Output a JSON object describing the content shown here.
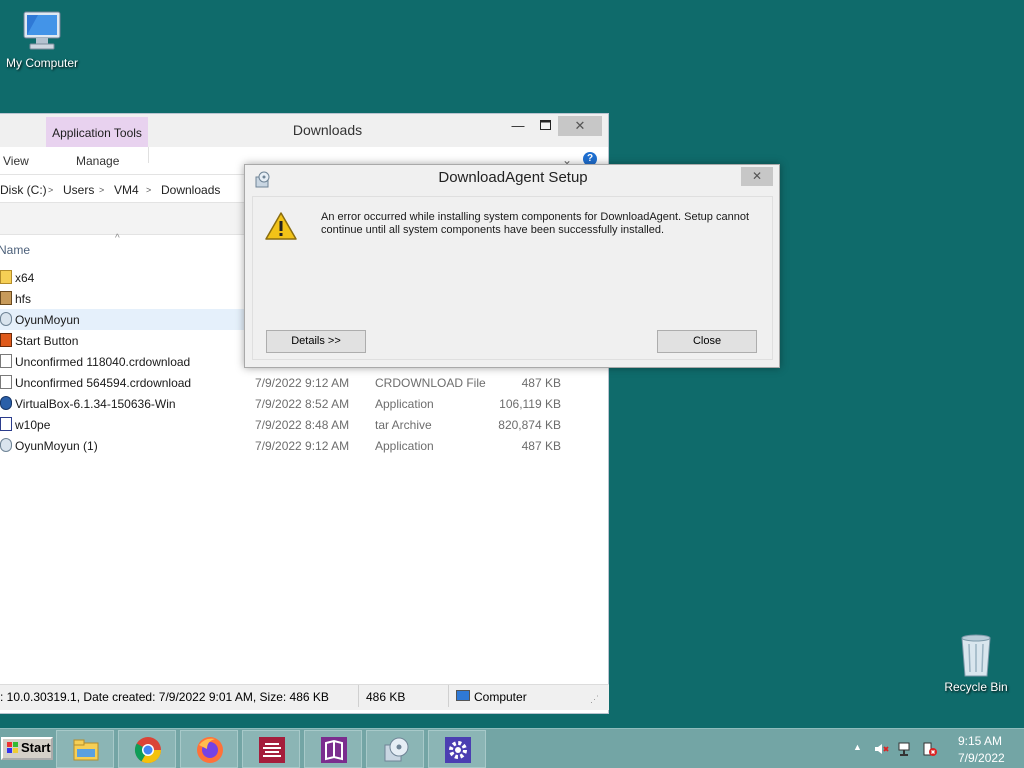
{
  "desktop": {
    "icons": [
      {
        "label": "My Computer"
      },
      {
        "label": "Recycle Bin"
      }
    ]
  },
  "explorer": {
    "title": "Downloads",
    "app_tools_tab": "Application Tools",
    "ribbon": {
      "view": "View",
      "manage": "Manage"
    },
    "breadcrumb": [
      "Disk (C:)",
      "Users",
      "VM4",
      "Downloads"
    ],
    "column_name": "Name",
    "files": [
      {
        "name": "x64",
        "date": "",
        "type": "",
        "size": "",
        "icon": "folder-icon"
      },
      {
        "name": "hfs",
        "date": "",
        "type": "",
        "size": "",
        "icon": "archive-icon"
      },
      {
        "name": "OyunMoyun",
        "date": "",
        "type": "",
        "size": "",
        "icon": "installer-icon"
      },
      {
        "name": "Start Button",
        "date": "",
        "type": "",
        "size": "",
        "icon": "image-icon"
      },
      {
        "name": "Unconfirmed 118040.crdownload",
        "date": "",
        "type": "",
        "size": "",
        "icon": "file-icon"
      },
      {
        "name": "Unconfirmed 564594.crdownload",
        "date": "7/9/2022 9:12 AM",
        "type": "CRDOWNLOAD File",
        "size": "487 KB",
        "icon": "file-icon"
      },
      {
        "name": "VirtualBox-6.1.34-150636-Win",
        "date": "7/9/2022 8:52 AM",
        "type": "Application",
        "size": "106,119 KB",
        "icon": "virtualbox-icon"
      },
      {
        "name": "w10pe",
        "date": "7/9/2022 8:48 AM",
        "type": "tar Archive",
        "size": "820,874 KB",
        "icon": "tar-icon"
      },
      {
        "name": "OyunMoyun (1)",
        "date": "7/9/2022 9:12 AM",
        "type": "Application",
        "size": "487 KB",
        "icon": "installer-icon"
      }
    ],
    "status_left": "KB",
    "details_text": ": 10.0.30319.1, Date created: 7/9/2022 9:01 AM, Size: 486 KB",
    "details_size": "486 KB",
    "details_location": "Computer"
  },
  "dialog": {
    "title": "DownloadAgent Setup",
    "message": "An error occurred while installing system components for DownloadAgent. Setup cannot continue until all system components have been successfully installed.",
    "details_button": "Details >>",
    "close_button": "Close",
    "close_glyph": "✕"
  },
  "taskbar": {
    "start_label": "Start",
    "apps": [
      "file-explorer",
      "chrome",
      "firefox",
      "text-editor",
      "office-suite",
      "setup-disc",
      "settings"
    ],
    "time": "9:15 AM",
    "date": "7/9/2022"
  },
  "colors": {
    "desktop": "#0f6b6b",
    "taskbar": "#73a5a5",
    "app_tools": "#e8d2ef",
    "selection": "#e5f0fb"
  }
}
